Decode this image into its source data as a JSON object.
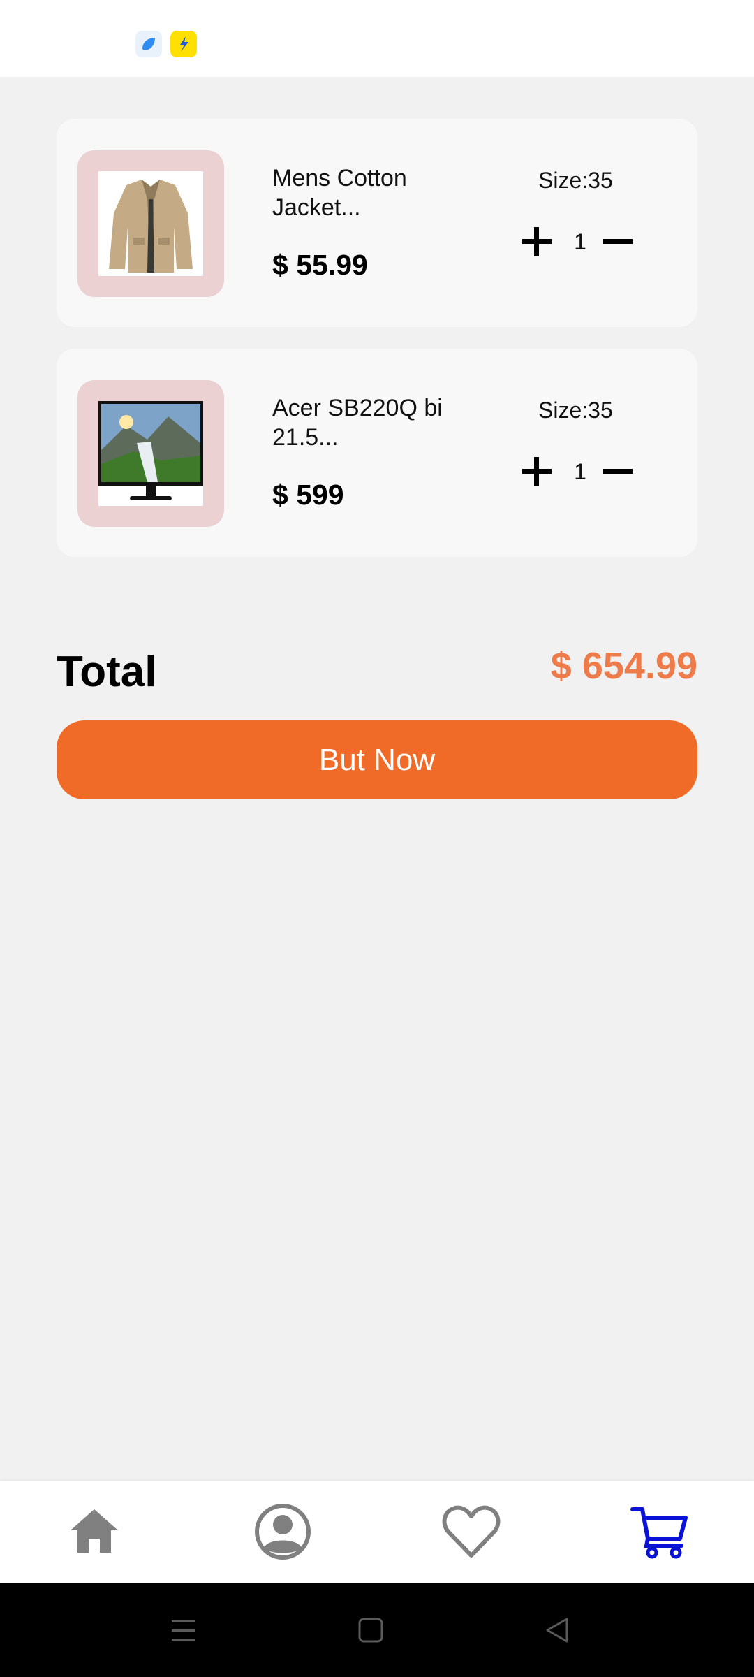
{
  "status_bar": {
    "notification_icons": [
      "notification-app-icon",
      "flipkart-app-icon"
    ]
  },
  "cart": {
    "items": [
      {
        "name": "Mens Cotton Jacket...",
        "price": "$ 55.99",
        "size": "Size:35",
        "quantity": "1",
        "image": "jacket-image"
      },
      {
        "name": "Acer SB220Q bi 21.5...",
        "price": "$ 599",
        "size": "Size:35",
        "quantity": "1",
        "image": "monitor-image"
      }
    ],
    "total_label": "Total",
    "total_value": "$ 654.99",
    "buy_label": "But Now"
  },
  "bottom_nav": {
    "items": [
      "home-icon",
      "profile-icon",
      "heart-icon",
      "cart-icon"
    ],
    "active": "cart-icon",
    "active_color": "#0a12d6",
    "inactive_color": "#808080"
  },
  "colors": {
    "accent": "#f06b27",
    "total_price": "#ee7b4a",
    "thumb_bg": "#ecd1d3"
  }
}
